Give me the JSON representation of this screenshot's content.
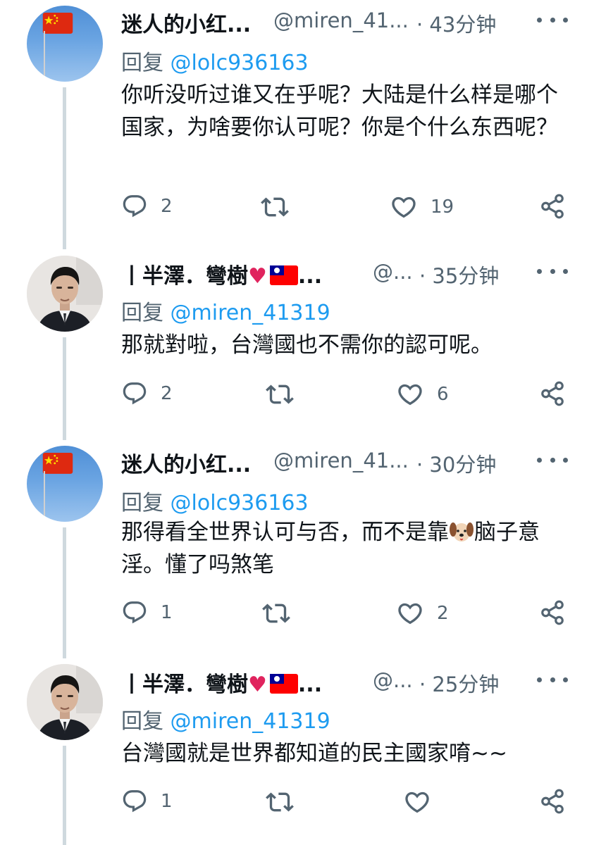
{
  "tweets": [
    {
      "author": "迷人的小红...",
      "handle": "@miren_41...",
      "time": "· 43分钟",
      "reply_prefix": "回复 ",
      "reply_to": "@lolc936163",
      "text": "你听没听过谁又在乎呢？大陆是什么样是哪个国家，为啥要你认可呢？你是个什么东西呢？",
      "reply_count": "2",
      "like_count": "19"
    },
    {
      "author": "丨半澤．彎樹",
      "author_suffix": "...",
      "handle": "@...",
      "time": "· 35分钟",
      "reply_prefix": "回复 ",
      "reply_to": "@miren_41319",
      "text": "那就對啦，台灣國也不需你的認可呢。",
      "reply_count": "2",
      "like_count": "6"
    },
    {
      "author": "迷人的小红...",
      "handle": "@miren_41...",
      "time": "· 30分钟",
      "reply_prefix": "回复 ",
      "reply_to": "@lolc936163",
      "text_before_emoji": "那得看全世界认可与否，而不是靠",
      "text_after_emoji": "脑子意淫。懂了吗煞笔",
      "reply_count": "1",
      "like_count": "2"
    },
    {
      "author": "丨半澤．彎樹",
      "author_suffix": "...",
      "handle": "@...",
      "time": "· 25分钟",
      "reply_prefix": "回复 ",
      "reply_to": "@miren_41319",
      "text": "台灣國就是世界都知道的民主國家唷~~",
      "reply_count": "1",
      "like_count": ""
    }
  ],
  "colors": {
    "secondary_text": "#536471",
    "mention": "#1d9bf0",
    "thread_line": "#cfd9de",
    "heart_emoji": "#e0245e"
  },
  "icons": [
    "reply-icon",
    "retweet-icon",
    "like-icon",
    "share-icon",
    "more-icon",
    "china-flag-icon",
    "taiwan-flag-icon",
    "heart-emoji-icon",
    "dog-emoji-icon"
  ]
}
